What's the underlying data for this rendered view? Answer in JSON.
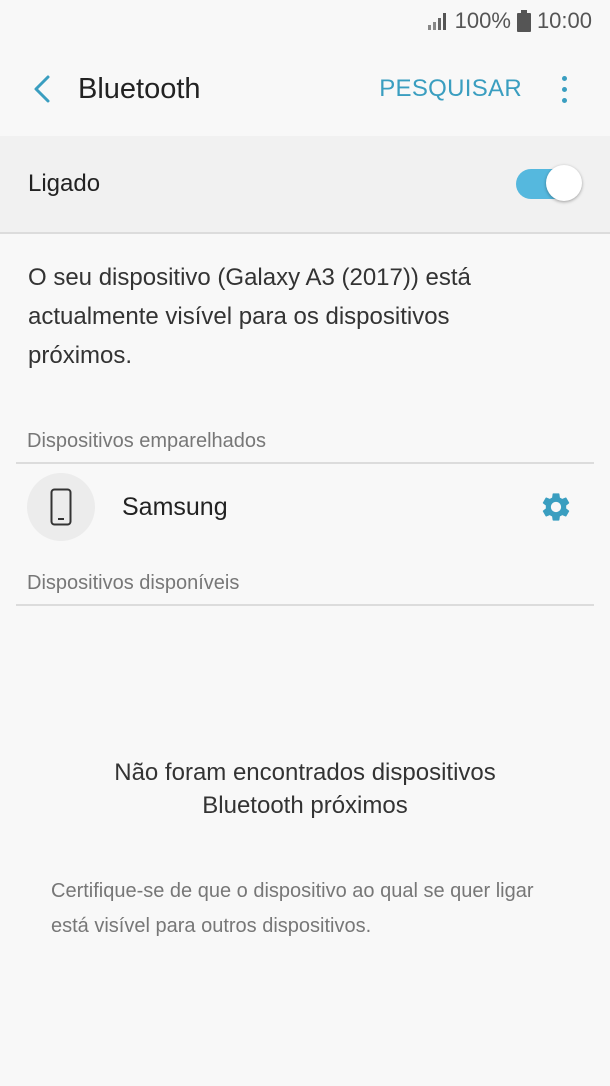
{
  "status_bar": {
    "battery_text": "100%",
    "time": "10:00",
    "icons": [
      "signal-icon",
      "battery-icon"
    ]
  },
  "app_bar": {
    "title": "Bluetooth",
    "search_label": "PESQUISAR",
    "icons": [
      "back-arrow-icon",
      "more-vertical-icon"
    ]
  },
  "master_switch": {
    "label": "Ligado",
    "on": true
  },
  "visibility_description": "O seu dispositivo (Galaxy A3 (2017)) está actualmente visível para os dispositivos próximos.",
  "paired_section": {
    "header": "Dispositivos emparelhados",
    "devices": [
      {
        "name": "Samsung",
        "icon": "smartphone-icon",
        "settings_icon": "gear-icon"
      }
    ]
  },
  "available_section": {
    "header": "Dispositivos disponíveis",
    "empty_title_line1": "Não foram encontrados dispositivos",
    "empty_title_line2": "Bluetooth próximos",
    "empty_hint": "Certifique-se de que o dispositivo ao qual se quer ligar está visível para outros dispositivos."
  },
  "colors": {
    "accent": "#3a9ec0",
    "toggle_on": "#55b8de",
    "background": "#f8f8f8"
  }
}
